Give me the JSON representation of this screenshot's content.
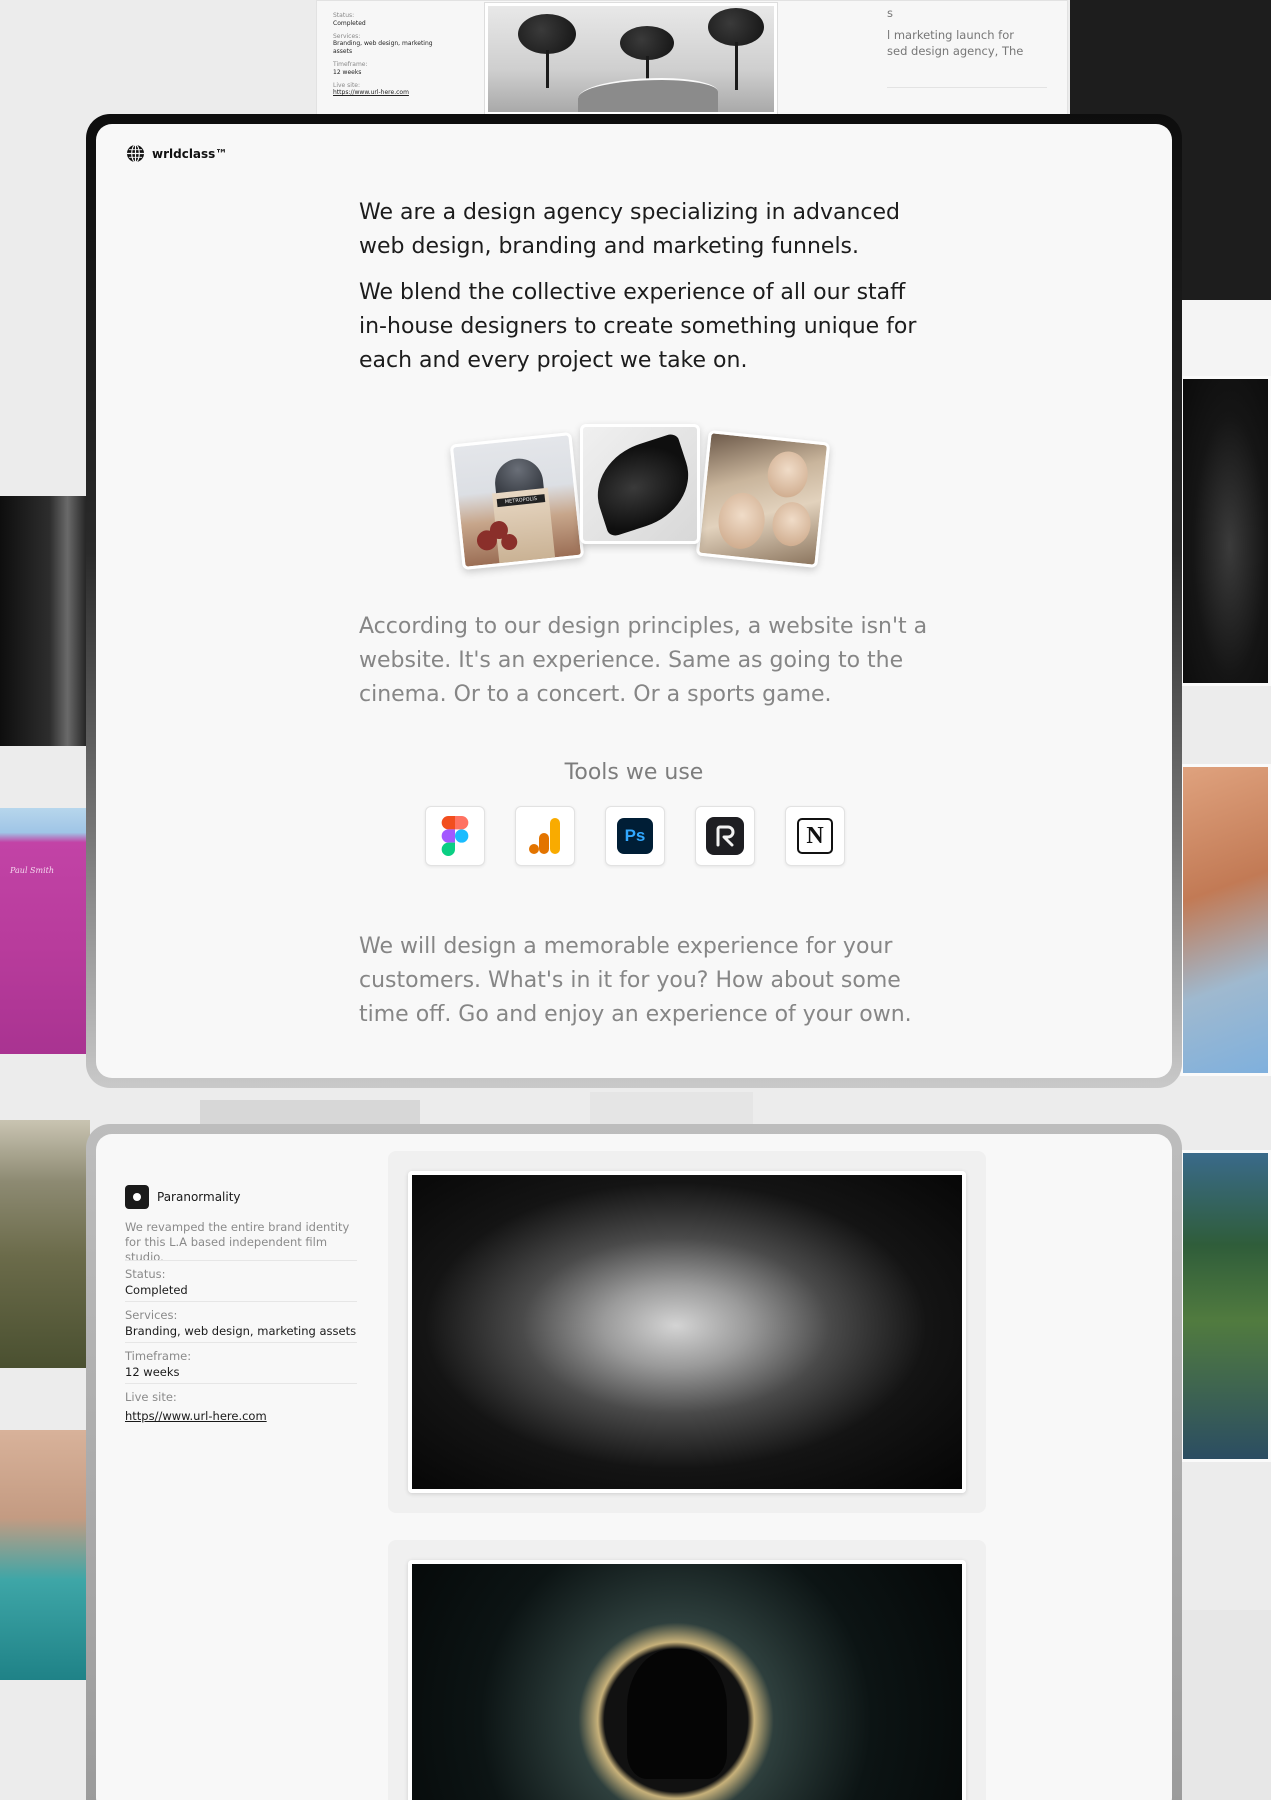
{
  "background": {
    "top_card": {
      "status_label": "Status:",
      "status_value": "Completed",
      "services_label": "Services:",
      "services_value": "Branding, web design, marketing assets",
      "timeframe_label": "Timeframe:",
      "timeframe_value": "12 weeks",
      "live_label": "Live site:",
      "live_value": "https://www.url-here.com",
      "text_line_1": "s",
      "text_line_2": "l marketing launch for",
      "text_line_3": "sed design agency, The"
    },
    "pink_photo_text": "Paul Smith"
  },
  "brand": {
    "name": "wrldclass™",
    "icon": "globe-icon"
  },
  "intro": {
    "paragraph_1": "We are a design agency specializing in advanced web design, branding and marketing funnels.",
    "paragraph_2": "We blend the collective experience of all our staff in-house designers to create something unique for each and every project we take on."
  },
  "gallery": {
    "photo_1_sign": "METROPOLIS"
  },
  "principle": "According to our design principles, a website isn't a website. It's an experience. Same as going to the cinema. Or to a concert. Or a sports game.",
  "tools": {
    "title": "Tools we use",
    "items": [
      {
        "icon": "figma-icon"
      },
      {
        "icon": "google-analytics-icon"
      },
      {
        "icon": "photoshop-icon",
        "label": "Ps"
      },
      {
        "icon": "raycast-icon"
      },
      {
        "icon": "notion-icon",
        "label": "N"
      }
    ]
  },
  "closing": "We will design a memorable experience for your customers. What's in it for you? How about some time off. Go and enjoy an experience of your own.",
  "project": {
    "name": "Paranormality",
    "description": "We revamped the entire brand identity for this L.A based independent film studio.",
    "meta": [
      {
        "label": "Status:",
        "value": "Completed"
      },
      {
        "label": "Services:",
        "value": "Branding, web design, marketing assets"
      },
      {
        "label": "Timeframe:",
        "value": "12 weeks"
      },
      {
        "label": "Live site:",
        "value": "https//www.url-here.com"
      }
    ]
  },
  "colors": {
    "page_bg": "#ececec",
    "card_bg": "#f8f8f8",
    "text_primary": "#1c1c1c",
    "text_secondary": "#868686",
    "ga_orange": "#f9ab00",
    "ps_blue": "#31a8ff"
  }
}
